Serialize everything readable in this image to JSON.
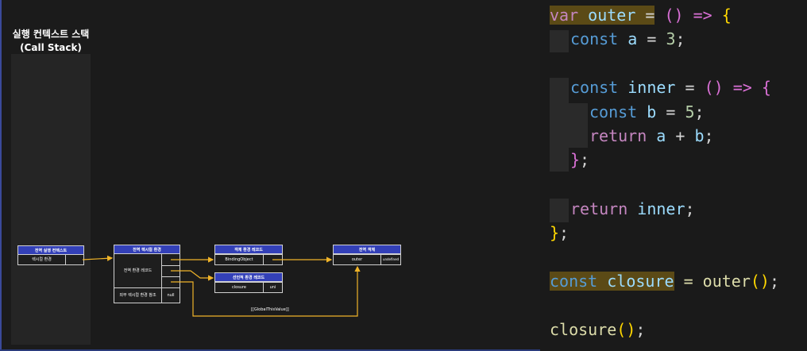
{
  "diagram": {
    "title_line1": "실행 컨텍스트 스택",
    "title_line2": "(Call Stack)",
    "global_exec_context": {
      "header": "전역 실행 컨텍스트",
      "cell": "렉시컬 환경"
    },
    "global_lexical_env": {
      "header": "전역 렉시컬 환경",
      "env_record": "전역 환경 레코드",
      "outer_ref": "외부 렉시컬 환경 참조",
      "outer_value": "null"
    },
    "object_env_record": {
      "header": "객체 환경 레코드",
      "cell": "BindingObject"
    },
    "declarative_env_record": {
      "header": "선언적 환경 레코드",
      "key": "closure",
      "value": "uni"
    },
    "global_object": {
      "header": "전역 객체",
      "key": "outer",
      "value": "undefined"
    },
    "global_this_label": "[[GlobalThisValue]]",
    "colors": {
      "header_bg": "#3340b8",
      "arrow": "#f0b429",
      "background": "#1b1b1b"
    }
  },
  "code": {
    "l1": {
      "a": "var",
      "b": " outer ",
      "c": "=",
      "d": " () => ",
      "e": "{"
    },
    "l2": {
      "a": "const",
      "b": " a ",
      "c": "= ",
      "d": "3",
      "e": ";"
    },
    "l4": {
      "a": "const",
      "b": " inner ",
      "c": "= ",
      "d": "() => ",
      "e": "{"
    },
    "l5": {
      "a": "const",
      "b": " b ",
      "c": "= ",
      "d": "5",
      "e": ";"
    },
    "l6": {
      "a": "return",
      "b": " a ",
      "c": "+ ",
      "d": "b",
      "e": ";"
    },
    "l7": {
      "a": "}",
      "b": ";"
    },
    "l9": {
      "a": "return",
      "b": " inner",
      "c": ";"
    },
    "l10": {
      "a": "}",
      "b": ";"
    },
    "l12": {
      "a": "const",
      "b": " ",
      "c": "closure",
      "d": " = outer",
      "e": "()",
      "f": ";"
    },
    "l14": {
      "a": "closure",
      "b": "()",
      "c": ";"
    }
  }
}
